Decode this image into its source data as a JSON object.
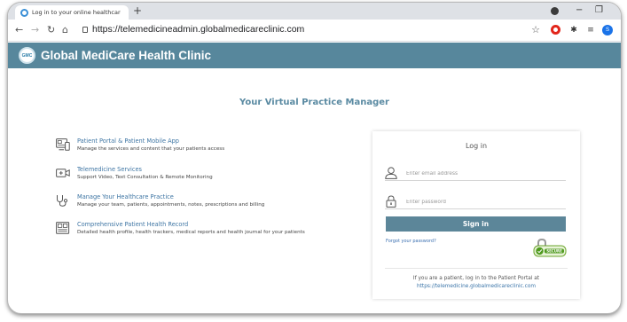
{
  "browser": {
    "tab_title": "Log in to your online healthcare ×",
    "tab_close": "×",
    "new_tab": "+",
    "url": "https://telemedicineadmin.globalmedicareclinic.com",
    "profile_initial": "S",
    "window_min": "−",
    "window_max": "❐"
  },
  "app": {
    "logo_text": "GMC",
    "title": "Global MediCare Health Clinic",
    "header_color": "#57879c"
  },
  "page": {
    "headline": "Your Virtual Practice Manager"
  },
  "features": [
    {
      "icon": "portal-app-icon",
      "title": "Patient Portal & Patient Mobile App",
      "description": "Manage the services and content that your patients access"
    },
    {
      "icon": "video-camera-icon",
      "title": "Telemedicine Services",
      "description": "Support Video, Text Consultation & Remote Monitoring"
    },
    {
      "icon": "stethoscope-icon",
      "title": "Manage Your Healthcare Practice",
      "description": "Manage your team, patients, appointments, notes, prescriptions and billing"
    },
    {
      "icon": "health-record-icon",
      "title": "Comprehensive Patient Health Record",
      "description": "Detailed health profile, health trackers, medical reports and health journal for your patients"
    }
  ],
  "login": {
    "title": "Log in",
    "email_placeholder": "Enter email address",
    "password_placeholder": "Enter password",
    "signin_label": "Sign in",
    "forgot_label": "Forgot your password?",
    "badge_text": "SECURE",
    "patient_note": "If you are a patient, log in to the Patient Portal at",
    "patient_link": "https://telemedicine.globalmedicareclinic.com"
  }
}
